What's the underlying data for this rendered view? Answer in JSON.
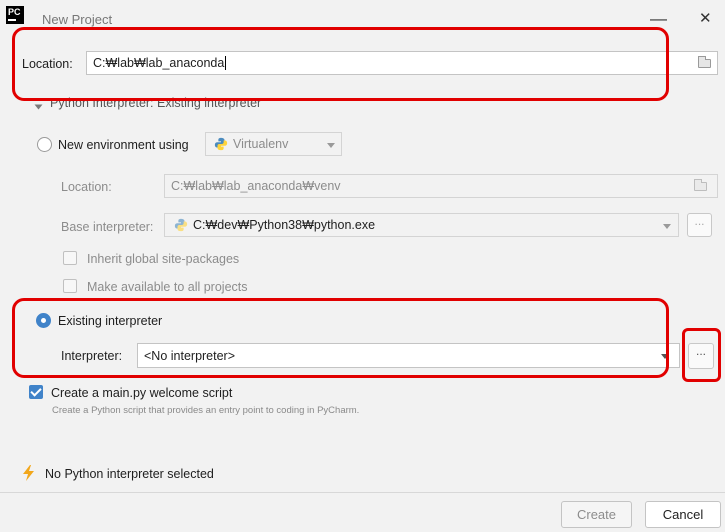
{
  "window": {
    "title": "New Project",
    "app_icon_text": "PC",
    "minimize_glyph": "—",
    "close_glyph": "✕"
  },
  "location": {
    "label": "Location:",
    "value": "C:₩lab₩lab_anaconda"
  },
  "interpreter_section": {
    "title": "Python Interpreter: Existing interpreter"
  },
  "new_env": {
    "label": "New environment using",
    "tool": "Virtualenv",
    "location_label": "Location:",
    "location_value": "C:₩lab₩lab_anaconda₩venv",
    "base_label": "Base interpreter:",
    "base_value": "C:₩dev₩Python38₩python.exe",
    "inherit_label": "Inherit global site-packages",
    "available_label": "Make available to all projects",
    "browse_label": "..."
  },
  "existing": {
    "label": "Existing interpreter",
    "interpreter_label": "Interpreter:",
    "interpreter_value": "<No interpreter>",
    "browse_label": "..."
  },
  "welcome": {
    "label": "Create a main.py welcome script",
    "description": "Create a Python script that provides an entry point to coding in PyCharm."
  },
  "status": {
    "message": "No Python interpreter selected"
  },
  "buttons": {
    "create": "Create",
    "cancel": "Cancel"
  },
  "colors": {
    "accent": "#4083c9",
    "highlight": "#e10000",
    "warning": "#f2a71b"
  }
}
